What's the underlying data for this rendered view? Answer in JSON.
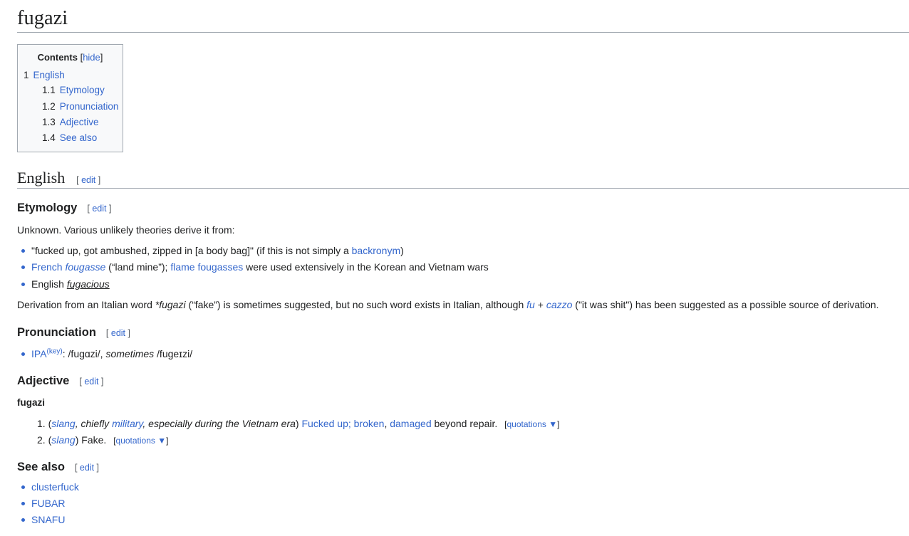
{
  "page_title": "fugazi",
  "toc": {
    "title": "Contents",
    "hide_open": "[",
    "hide_label": "hide",
    "hide_close": "]",
    "items": [
      {
        "num": "1",
        "label": "English"
      },
      {
        "num": "1.1",
        "label": "Etymology"
      },
      {
        "num": "1.2",
        "label": "Pronunciation"
      },
      {
        "num": "1.3",
        "label": "Adjective"
      },
      {
        "num": "1.4",
        "label": "See also"
      }
    ]
  },
  "edit": {
    "open": "[ ",
    "label": "edit",
    "close": " ]"
  },
  "english": {
    "heading": "English"
  },
  "etymology": {
    "heading": "Etymology",
    "intro": "Unknown. Various unlikely theories derive it from:",
    "b1": {
      "text": "\"fucked up, got ambushed, zipped in [a body bag]\" (if this is not simply a ",
      "link": "backronym",
      "end": ")"
    },
    "b2": {
      "link1": "French ",
      "link1_italic": "fougasse",
      "mid": " (“land mine”); ",
      "link2": "flame fougasses",
      "end": " were used extensively in the Korean and Vietnam wars"
    },
    "b3": {
      "text": "English ",
      "link": "fugacious"
    },
    "derivation": {
      "t1": "Derivation from an Italian word ",
      "t2": "*fugazi",
      "t3": " (“fake”) is sometimes suggested, but no such word exists in Italian, although ",
      "l1": "fu",
      "t4": " + ",
      "l2": "cazzo",
      "t5": " (\"it was shit\") has been suggested as a possible source of derivation."
    }
  },
  "pronunciation": {
    "heading": "Pronunciation",
    "ipa_link": "IPA",
    "key": "(key)",
    "colon": ": /fuɡɑzi/, ",
    "sometimes": "sometimes",
    "alt": " /fuɡeɪzi/"
  },
  "adjective": {
    "heading": "Adjective",
    "headword": "fugazi",
    "sense1": {
      "num": "1.",
      "p_open": "(",
      "slang": "slang",
      "comma1": ", chiefly ",
      "military": "military",
      "rest": ", especially during the Vietnam era",
      "p_close": ") ",
      "def_link1": "Fucked up",
      "semi": "; ",
      "def_link2": "broken",
      "comma2": ", ",
      "def_link3": "damaged",
      "def_end": " beyond repair."
    },
    "sense2": {
      "num": "2.",
      "p_open": "(",
      "slang": "slang",
      "p_close": ") ",
      "def": "Fake."
    },
    "quotations": {
      "open": "[",
      "label": "quotations ▼",
      "close": "]"
    }
  },
  "see_also": {
    "heading": "See also",
    "items": [
      "clusterfuck",
      "FUBAR",
      "SNAFU"
    ]
  },
  "colors": {
    "link": "#3366cc",
    "text": "#202122",
    "border": "#a2a9b1",
    "toc_bg": "#f8f9fa"
  }
}
